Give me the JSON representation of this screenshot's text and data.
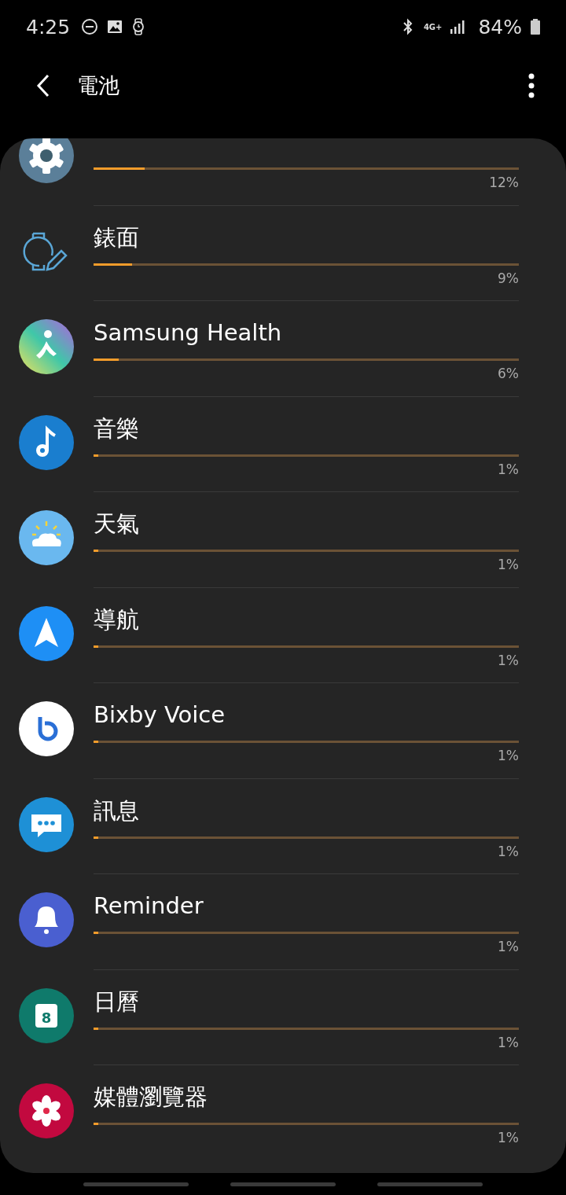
{
  "status_bar": {
    "time": "4:25",
    "network": "4G+",
    "battery": "84%"
  },
  "header": {
    "title": "電池"
  },
  "apps": [
    {
      "kind": "gear",
      "level": 0.12,
      "percent": "12%"
    },
    {
      "name": "錶面",
      "kind": "watchface",
      "level": 0.09,
      "percent": "9%"
    },
    {
      "name": "Samsung Health",
      "kind": "health",
      "level": 0.06,
      "percent": "6%"
    },
    {
      "name": "音樂",
      "kind": "music",
      "level": 0.01,
      "percent": "1%"
    },
    {
      "name": "天氣",
      "kind": "weather",
      "level": 0.01,
      "percent": "1%"
    },
    {
      "name": "導航",
      "kind": "navigation",
      "level": 0.01,
      "percent": "1%"
    },
    {
      "name": "Bixby Voice",
      "kind": "bixby",
      "level": 0.01,
      "percent": "1%"
    },
    {
      "name": "訊息",
      "kind": "message",
      "level": 0.01,
      "percent": "1%"
    },
    {
      "name": "Reminder",
      "kind": "bell",
      "level": 0.01,
      "percent": "1%"
    },
    {
      "name": "日曆",
      "kind": "calendar",
      "level": 0.01,
      "percent": "1%",
      "day": "8"
    },
    {
      "name": "媒體瀏覽器",
      "kind": "gallery",
      "level": 0.01,
      "percent": "1%"
    }
  ]
}
